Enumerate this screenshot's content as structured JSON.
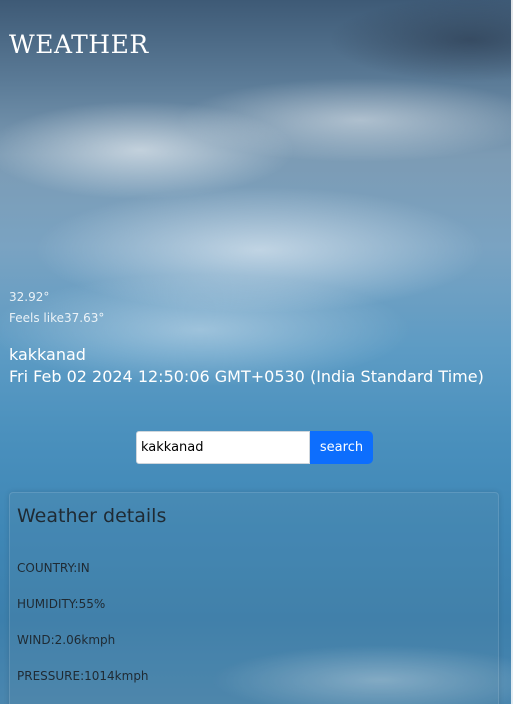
{
  "app": {
    "title": "WEATHER"
  },
  "current": {
    "temperature": "32.92°",
    "feels_like": "Feels like37.63°",
    "location": "kakkanad",
    "datetime": "Fri Feb 02 2024 12:50:06 GMT+0530 (India Standard Time)"
  },
  "search": {
    "value": "kakkanad",
    "button_label": "search"
  },
  "details": {
    "title": "Weather details",
    "country": "COUNTRY:IN",
    "humidity": "HUMIDITY:55%",
    "wind": "WIND:2.06kmph",
    "pressure": "PRESSURE:1014kmph"
  },
  "colors": {
    "button": "#0d6efd",
    "sky": "#4a90bd"
  }
}
